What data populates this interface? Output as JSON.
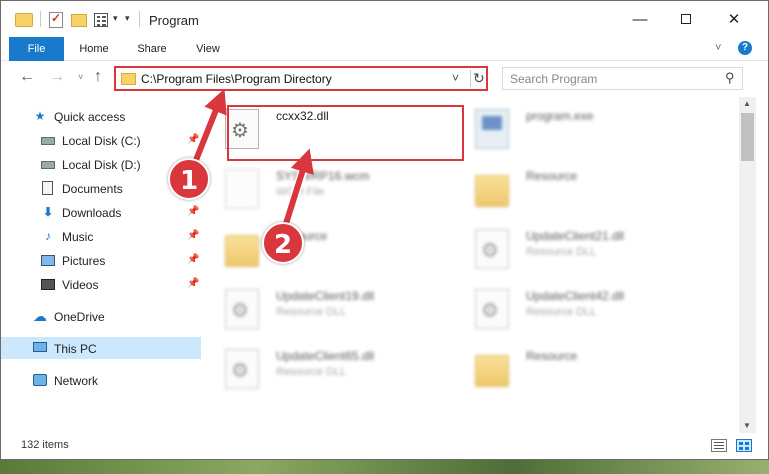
{
  "window": {
    "title": "Program",
    "controls": {
      "minimize": "—",
      "maximize": "",
      "close": "✕"
    }
  },
  "ribbon": {
    "tabs": [
      "File",
      "Home",
      "Share",
      "View"
    ],
    "help": "?"
  },
  "address": {
    "path": "C:\\Program Files\\Program Directory",
    "search_placeholder": "Search Program"
  },
  "nav": {
    "items": [
      {
        "label": "Quick access",
        "icon": "star-icon",
        "pinned": false
      },
      {
        "label": "Local Disk (C:)",
        "icon": "local-disk-icon",
        "pinned": true
      },
      {
        "label": "Local Disk (D:)",
        "icon": "local-disk-icon",
        "pinned": false
      },
      {
        "label": "Documents",
        "icon": "documents-icon",
        "pinned": false
      },
      {
        "label": "Downloads",
        "icon": "downloads-icon",
        "pinned": true
      },
      {
        "label": "Music",
        "icon": "music-icon",
        "pinned": true
      },
      {
        "label": "Pictures",
        "icon": "pictures-icon",
        "pinned": true
      },
      {
        "label": "Videos",
        "icon": "videos-icon",
        "pinned": true
      },
      {
        "label": "OneDrive",
        "icon": "onedrive-icon",
        "pinned": false
      },
      {
        "label": "This PC",
        "icon": "this-pc-icon",
        "pinned": false,
        "selected": true
      },
      {
        "label": "Network",
        "icon": "network-icon",
        "pinned": false
      }
    ]
  },
  "files": [
    {
      "name": "ccxx32.dll",
      "type": "",
      "icon": "dll-file-icon",
      "highlighted": true
    },
    {
      "name": "program.exe",
      "type": "",
      "icon": "exe-file-icon"
    },
    {
      "name": "SYSWRP16.wcm",
      "type": "WCM File",
      "icon": "wcm-file-icon"
    },
    {
      "name": "Resource",
      "type": "",
      "icon": "folder-icon"
    },
    {
      "name": "Resource",
      "type": "",
      "icon": "folder-icon"
    },
    {
      "name": "UpdateClient21.dll",
      "type": "Resource DLL",
      "icon": "dll-file-icon"
    },
    {
      "name": "UpdateClient19.dll",
      "type": "Resource DLL",
      "icon": "dll-file-icon"
    },
    {
      "name": "UpdateClient42.dll",
      "type": "Resource DLL",
      "icon": "dll-file-icon"
    },
    {
      "name": "UpdateClient65.dll",
      "type": "Resource DLL",
      "icon": "dll-file-icon"
    },
    {
      "name": "Resource",
      "type": "",
      "icon": "folder-icon"
    }
  ],
  "status": {
    "item_count": "132 items"
  },
  "annotations": {
    "step1": "1",
    "step2": "2"
  },
  "colors": {
    "accent": "#1979ca",
    "annotation": "#d9363e",
    "selected": "#cce8ff"
  }
}
